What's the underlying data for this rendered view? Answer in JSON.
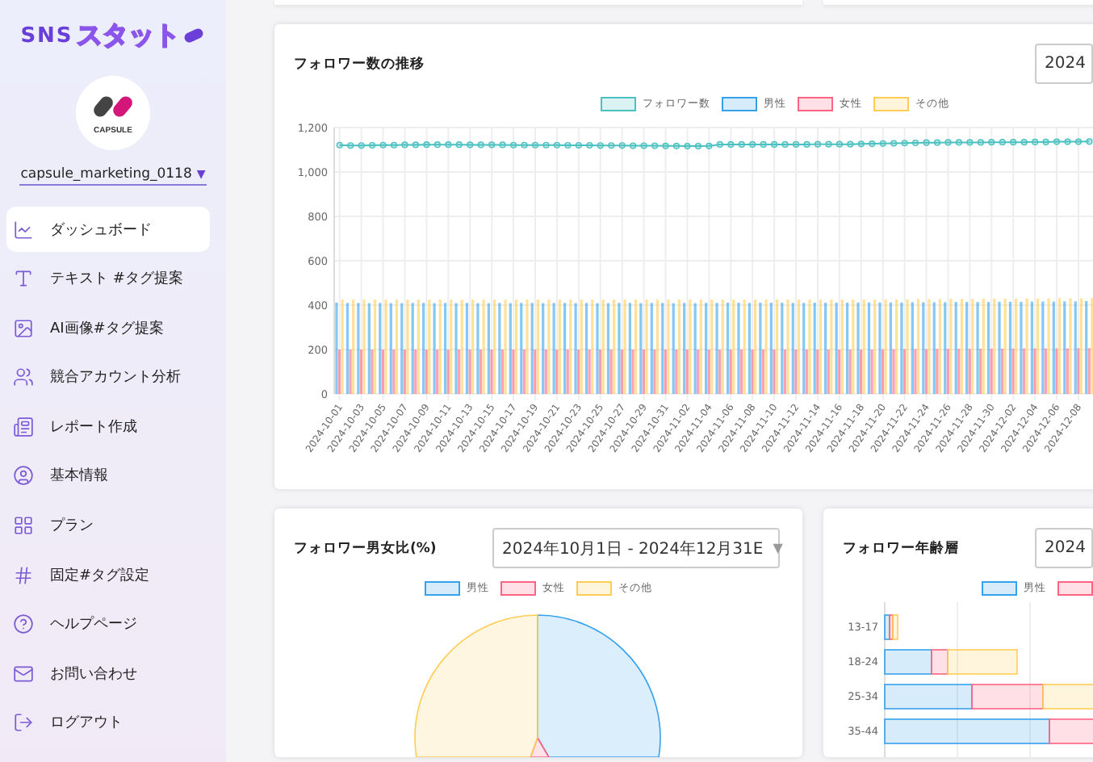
{
  "sidebar": {
    "logo": {
      "prefix": "SNS",
      "name": "スタット"
    },
    "avatar": {
      "label": "CAPSULE"
    },
    "account": {
      "name": "capsule_marketing_0118",
      "caret": "▼"
    },
    "nav": [
      {
        "label": "ダッシュボード",
        "kind": "chart",
        "selected": true
      },
      {
        "label": "テキスト #タグ提案",
        "kind": "text",
        "selected": false
      },
      {
        "label": "AI画像#タグ提案",
        "kind": "image",
        "selected": false
      },
      {
        "label": "競合アカウント分析",
        "kind": "users",
        "selected": false
      },
      {
        "label": "レポート作成",
        "kind": "report",
        "selected": false
      },
      {
        "label": "基本情報",
        "kind": "profile",
        "selected": false
      },
      {
        "label": "プラン",
        "kind": "grid",
        "selected": false
      },
      {
        "label": "固定#タグ設定",
        "kind": "hash",
        "selected": false
      },
      {
        "label": "ヘルプページ",
        "kind": "help",
        "selected": false
      },
      {
        "label": "お問い合わせ",
        "kind": "mail",
        "selected": false
      },
      {
        "label": "ログアウト",
        "kind": "logout",
        "selected": false
      }
    ]
  },
  "follower_trend": {
    "title": "フォロワー数の推移",
    "date_select": "2024",
    "chart_data": {
      "type": "bar",
      "grid": true,
      "ylim": [
        0,
        1200
      ],
      "yticks": [
        0,
        200,
        400,
        600,
        800,
        {
          "value": 1000,
          "label": "1,000"
        },
        {
          "value": 1200,
          "label": "1,200"
        }
      ],
      "categories": [
        "2024-10-01",
        null,
        "2024-10-03",
        null,
        "2024-10-05",
        null,
        "2024-10-07",
        null,
        "2024-10-09",
        null,
        "2024-10-11",
        null,
        "2024-10-13",
        null,
        "2024-10-15",
        null,
        "2024-10-17",
        null,
        "2024-10-19",
        null,
        "2024-10-21",
        null,
        "2024-10-23",
        null,
        "2024-10-25",
        null,
        "2024-10-27",
        null,
        "2024-10-29",
        null,
        "2024-10-31",
        null,
        "2024-11-02",
        null,
        "2024-11-04",
        null,
        "2024-11-06",
        null,
        "2024-11-08",
        null,
        "2024-11-10",
        null,
        "2024-11-12",
        null,
        "2024-11-14",
        null,
        "2024-11-16",
        null,
        "2024-11-18",
        null,
        "2024-11-20",
        null,
        "2024-11-22",
        null,
        "2024-11-24",
        null,
        "2024-11-26",
        null,
        "2024-11-28",
        null,
        "2024-11-30",
        null,
        "2024-12-02",
        null,
        "2024-12-04",
        null,
        "2024-12-06",
        null,
        "2024-12-08",
        null
      ],
      "series": [
        {
          "name": "フォロワー数",
          "type": "line",
          "marker": true,
          "color": "#4bc0c0",
          "values": [
            1121,
            1119,
            1119,
            1120,
            1121,
            1121,
            1122,
            1122,
            1123,
            1123,
            1123,
            1123,
            1122,
            1122,
            1122,
            1122,
            1121,
            1121,
            1121,
            1121,
            1121,
            1120,
            1120,
            1120,
            1119,
            1119,
            1119,
            1118,
            1118,
            1118,
            1117,
            1117,
            1116,
            1116,
            1117,
            1124,
            1124,
            1124,
            1124,
            1124,
            1124,
            1124,
            1124,
            1124,
            1125,
            1125,
            1125,
            1125,
            1126,
            1127,
            1128,
            1129,
            1130,
            1131,
            1132,
            1132,
            1133,
            1133,
            1133,
            1133,
            1134,
            1134,
            1134,
            1134,
            1135,
            1135,
            1136,
            1136,
            1136,
            1137
          ]
        },
        {
          "name": "男性",
          "color": "#36a2eb",
          "values": [
            411,
            410,
            410,
            409,
            410,
            409,
            409,
            410,
            410,
            409,
            410,
            409,
            410,
            409,
            409,
            410,
            409,
            410,
            410,
            409,
            410,
            410,
            409,
            410,
            409,
            409,
            410,
            410,
            409,
            410,
            410,
            409,
            410,
            409,
            410,
            410,
            411,
            411,
            410,
            411,
            411,
            411,
            410,
            410,
            411,
            411,
            411,
            411,
            412,
            412,
            412,
            412,
            412,
            413,
            413,
            413,
            413,
            414,
            414,
            414,
            414,
            415,
            415,
            415,
            416,
            416,
            416,
            417,
            417,
            418
          ]
        },
        {
          "name": "女性",
          "color": "#ff6384",
          "values": [
            200,
            200,
            200,
            200,
            200,
            200,
            200,
            200,
            200,
            200,
            200,
            200,
            200,
            200,
            200,
            200,
            200,
            200,
            200,
            200,
            200,
            200,
            200,
            200,
            200,
            200,
            200,
            200,
            200,
            200,
            200,
            200,
            200,
            200,
            200,
            200,
            200,
            200,
            200,
            200,
            200,
            200,
            200,
            200,
            200,
            200,
            200,
            200,
            200,
            200,
            201,
            201,
            202,
            202,
            202,
            203,
            203,
            203,
            203,
            204,
            204,
            204,
            204,
            205,
            205,
            205,
            205,
            205,
            206,
            206
          ]
        },
        {
          "name": "その他",
          "color": "#ffcd56",
          "values": [
            425,
            425,
            425,
            425,
            425,
            425,
            425,
            425,
            425,
            425,
            425,
            425,
            425,
            425,
            425,
            425,
            425,
            425,
            425,
            425,
            425,
            425,
            425,
            425,
            425,
            425,
            425,
            425,
            425,
            425,
            425,
            425,
            425,
            425,
            425,
            425,
            425,
            425,
            425,
            425,
            425,
            425,
            425,
            425,
            425,
            425,
            425,
            425,
            425,
            425,
            426,
            426,
            426,
            427,
            427,
            427,
            428,
            428,
            428,
            428,
            429,
            429,
            429,
            430,
            430,
            430,
            431,
            431,
            431,
            432
          ]
        }
      ]
    }
  },
  "gender_ratio": {
    "title": "フォロワー男女比(%)",
    "date_select": "2024年10月1日 - 2024年12月31E",
    "caret": "▼",
    "legend": [
      {
        "label": "男性",
        "color": "#36a2eb"
      },
      {
        "label": "女性",
        "color": "#ff6384"
      },
      {
        "label": "その他",
        "color": "#ffcd56"
      }
    ]
  },
  "age_groups": {
    "title": "フォロワー年齢層",
    "date_select": "2024",
    "legend": [
      {
        "label": "男性",
        "color": "#36a2eb"
      },
      {
        "color": "#ff6384"
      }
    ],
    "rows": [
      "13-17",
      "18-24",
      "25-34",
      "35-44"
    ]
  }
}
